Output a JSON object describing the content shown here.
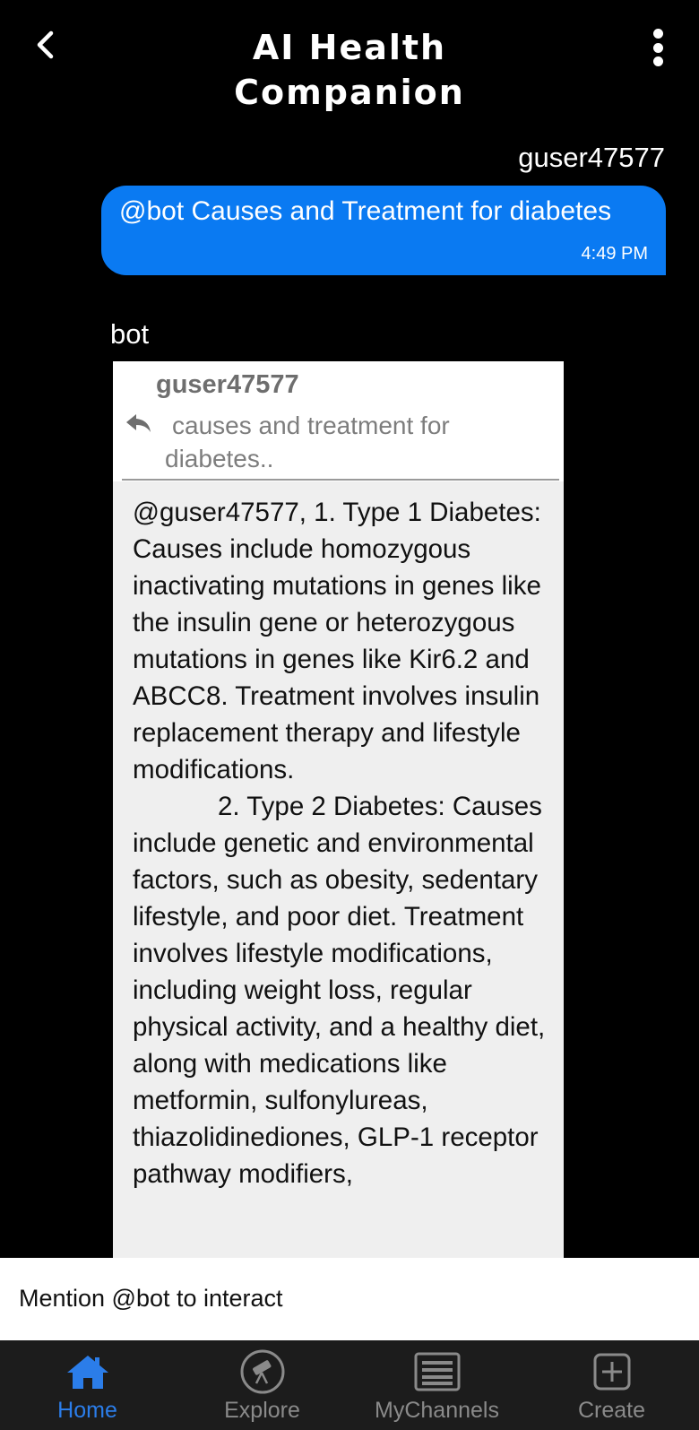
{
  "header": {
    "title_line1": "AI Health",
    "title_line2": "Companion"
  },
  "messages": {
    "outgoing": {
      "sender": "guser47577",
      "text": "@bot Causes and Treatment for diabetes",
      "time": "4:49 PM",
      "bubble_color": "#0a7af2"
    },
    "incoming": {
      "sender": "bot",
      "quote_user": "guser47577",
      "quote_text": "causes and treatment for diabetes..",
      "paragraph1": "@guser47577, 1. Type 1 Diabetes: Causes include homozygous inactivating mutations in genes like the insulin gene or heterozygous mutations in genes like Kir6.2 and ABCC8. Treatment involves insulin replacement therapy and lifestyle modifications.",
      "paragraph2": "2. Type 2 Diabetes: Causes include genetic and environmental factors, such as obesity, sedentary lifestyle, and poor diet. Treatment involves lifestyle modifications, including weight loss, regular physical activity, and a healthy diet, along with medications like metformin, sulfonylureas, thiazolidinediones, GLP-1 receptor pathway modifiers,"
    }
  },
  "composer": {
    "placeholder": "Mention @bot to interact"
  },
  "bottom_nav": {
    "active_color": "#2b7de9",
    "items": [
      {
        "label": "Home",
        "icon": "home-icon"
      },
      {
        "label": "Explore",
        "icon": "telescope-icon"
      },
      {
        "label": "MyChannels",
        "icon": "list-icon"
      },
      {
        "label": "Create",
        "icon": "plus-square-icon"
      }
    ]
  }
}
